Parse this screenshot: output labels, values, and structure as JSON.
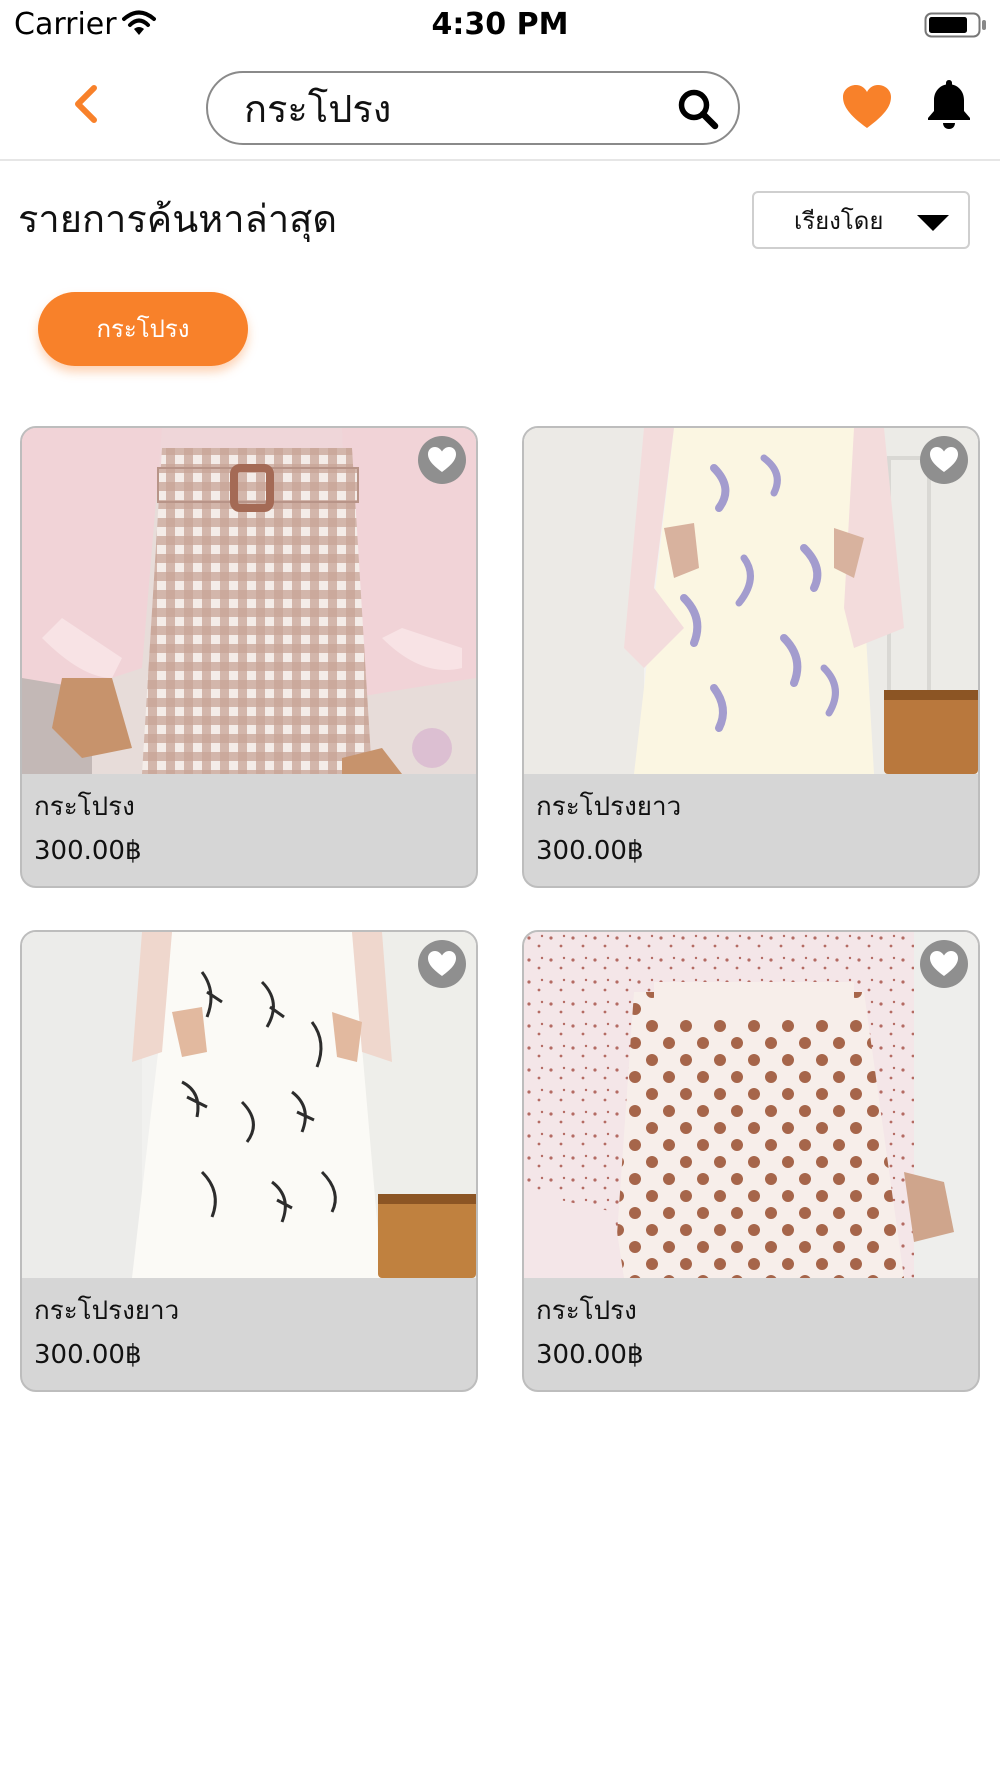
{
  "status_bar": {
    "carrier": "Carrier",
    "time": "4:30 PM"
  },
  "header": {
    "search": {
      "value": "กระโปรง"
    },
    "icons": {
      "back": "chevron-left-icon",
      "search": "search-icon",
      "favorites": "heart-icon",
      "notifications": "bell-icon"
    }
  },
  "recent": {
    "title": "รายการค้นหาล่าสุด",
    "sort_label": "เรียงโดย",
    "chips": [
      "กระโปรง"
    ]
  },
  "products": [
    {
      "name": "กระโปรง",
      "price": "300.00฿",
      "image": "pink-gingham-skirt"
    },
    {
      "name": "กระโปรงยาว",
      "price": "300.00฿",
      "image": "cream-leaf-print-skirt"
    },
    {
      "name": "กระโปรงยาว",
      "price": "300.00฿",
      "image": "white-floral-sketch-skirt"
    },
    {
      "name": "กระโปรง",
      "price": "300.00฿",
      "image": "polka-dot-skirt"
    }
  ],
  "colors": {
    "accent": "#f8812a",
    "card_background": "#d6d6d6",
    "card_border": "#bdbdbd",
    "favorite_button": "#8f8f8f"
  }
}
